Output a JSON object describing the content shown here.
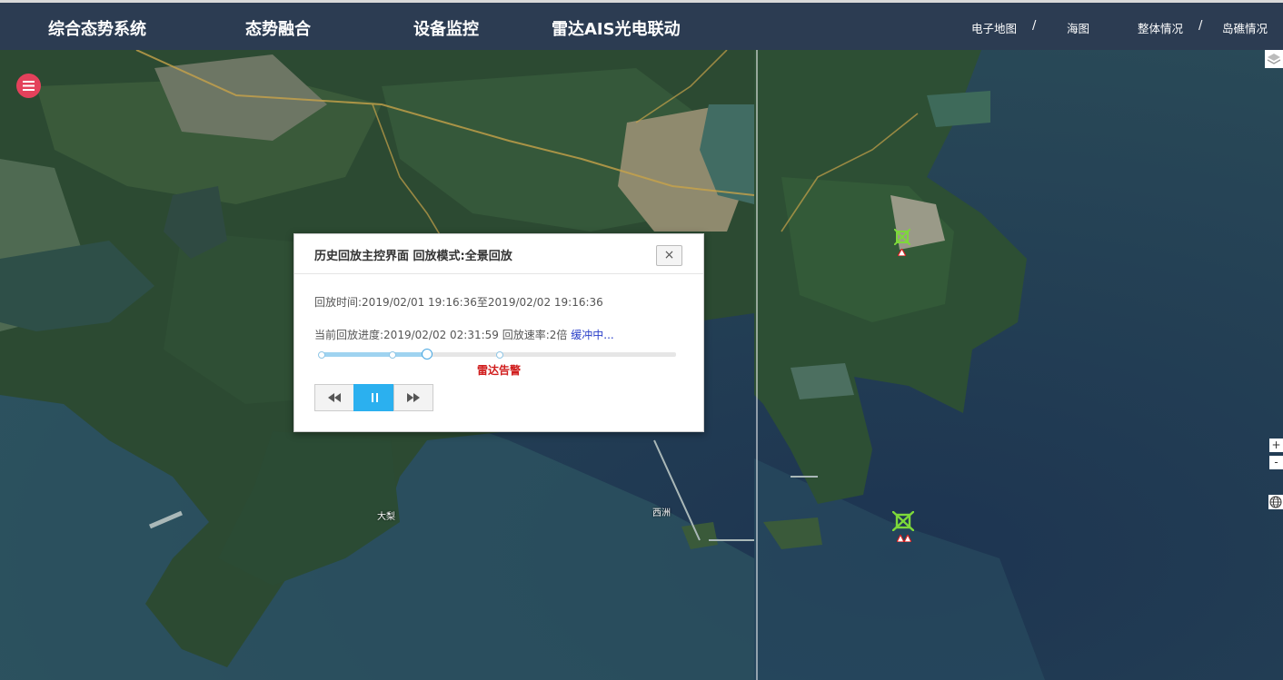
{
  "header": {
    "nav_main": [
      "综合态势系统",
      "态势融合",
      "设备监控",
      "雷达AIS光电联动"
    ],
    "nav_right": [
      "电子地图",
      "海图",
      "整体情况",
      "岛礁情况"
    ],
    "separator": "/",
    "active_item": "电子地图",
    "active_color": "#e03a3a"
  },
  "map": {
    "labels": [
      "大梨",
      "西洲"
    ],
    "zoom_in": "+",
    "zoom_out": "-",
    "icons": [
      "menu-icon",
      "layers-icon",
      "globe-icon",
      "radar-target-icon",
      "alarm-marker-icon"
    ]
  },
  "dialog": {
    "title": "历史回放主控界面 回放模式:全景回放",
    "close_symbol": "×",
    "playback_time_label": "回放时间:2019/02/01 19:16:36至2019/02/02 19:16:36",
    "progress_text": "当前回放进度:2019/02/02 02:31:59 回放速率:2倍",
    "buffer_status": "缓冲中...",
    "alarm_label": "雷达告警",
    "progress_fraction": 0.3,
    "controls": [
      "rewind-icon",
      "pause-icon",
      "fast-forward-icon"
    ],
    "accent_color": "#2bb0ef"
  }
}
